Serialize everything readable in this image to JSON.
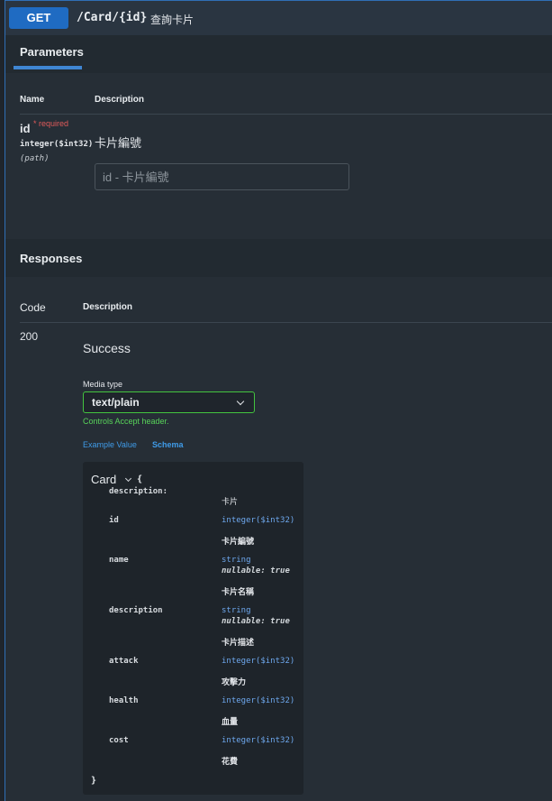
{
  "summary": {
    "method": "GET",
    "path": "/Card/{id}",
    "description": "查詢卡片"
  },
  "parameters": {
    "tab_label": "Parameters",
    "col_name": "Name",
    "col_description": "Description",
    "param": {
      "name": "id",
      "required_label": "* required",
      "type": "integer($int32)",
      "in": "(path)",
      "description": "卡片編號",
      "placeholder": "id - 卡片編號"
    }
  },
  "responses": {
    "title": "Responses",
    "col_code": "Code",
    "col_description": "Description",
    "row": {
      "code": "200",
      "description": "Success",
      "media_type_label": "Media type",
      "media_type_value": "text/plain",
      "accept_note": "Controls Accept header.",
      "example_tab": "Example Value",
      "schema_tab": "Schema"
    }
  },
  "model": {
    "title": "Card",
    "open_brace": "{",
    "close_brace": "}",
    "model_description_key": "description:",
    "model_description": "卡片",
    "properties": [
      {
        "name": "id",
        "type": "integer($int32)",
        "nullable": "",
        "description": "卡片編號"
      },
      {
        "name": "name",
        "type": "string",
        "nullable": "nullable: true",
        "description": "卡片名稱"
      },
      {
        "name": "description",
        "type": "string",
        "nullable": "nullable: true",
        "description": "卡片描述"
      },
      {
        "name": "attack",
        "type": "integer($int32)",
        "nullable": "",
        "description": "攻擊力"
      },
      {
        "name": "health",
        "type": "integer($int32)",
        "nullable": "",
        "description": "血量"
      },
      {
        "name": "cost",
        "type": "integer($int32)",
        "nullable": "",
        "description": "花費"
      }
    ]
  },
  "colors": {
    "method_get": "#1f6bc2",
    "border_accent": "#2f6fb6",
    "required": "#e05a5a",
    "select_border": "#43c43f",
    "link": "#3f9be8",
    "type_text": "#6ea8ee"
  }
}
